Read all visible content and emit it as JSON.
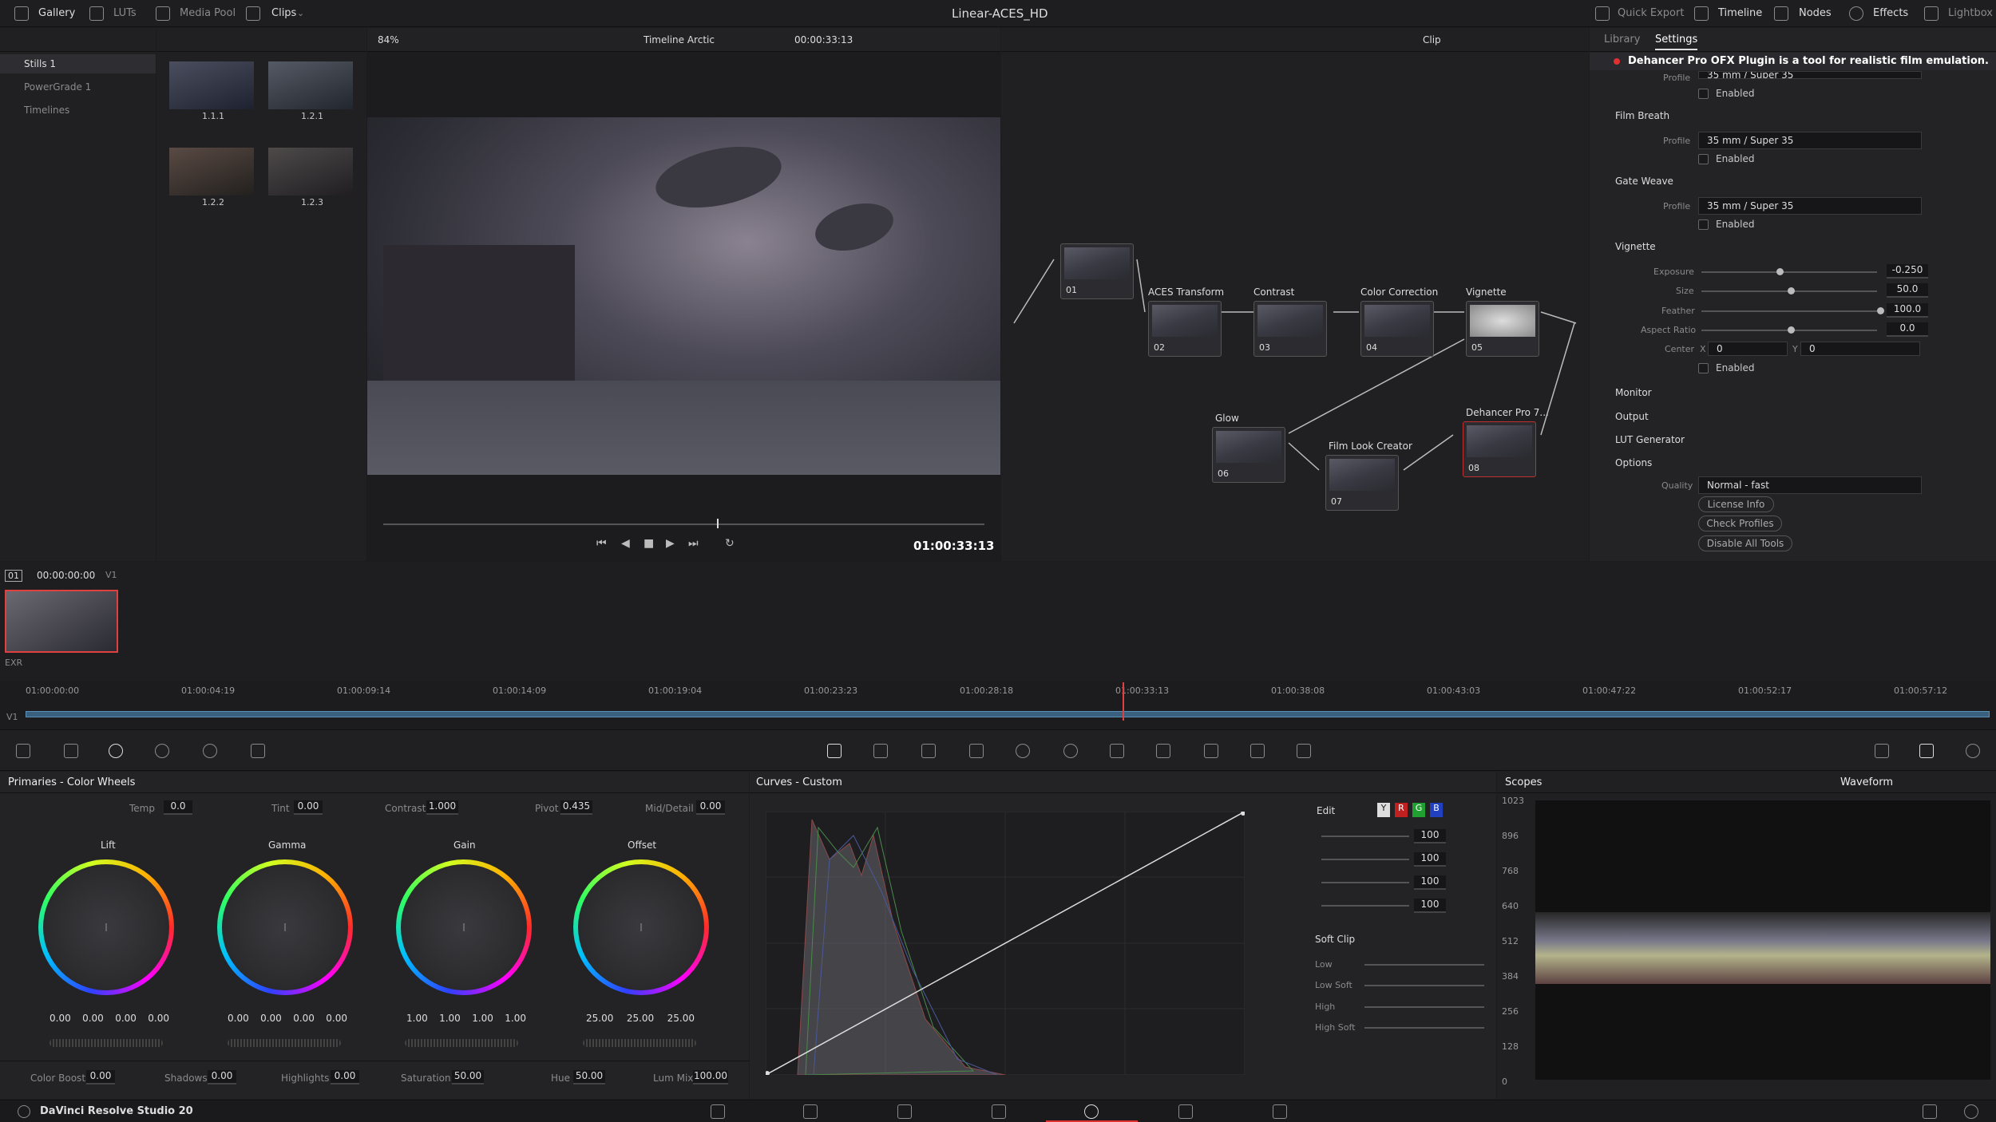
{
  "app": {
    "title": "Linear-ACES_HD",
    "brand": "DaVinci Resolve Studio 20"
  },
  "topbar": {
    "gallery": "Gallery",
    "luts": "LUTs",
    "media_pool": "Media Pool",
    "clips": "Clips",
    "quick_export": "Quick Export",
    "timeline": "Timeline",
    "nodes": "Nodes",
    "effects": "Effects",
    "lightbox": "Lightbox"
  },
  "gallery": {
    "items": [
      "Stills 1",
      "PowerGrade 1",
      "Timelines"
    ],
    "stills": [
      "1.1.1",
      "1.2.1",
      "1.2.2",
      "1.2.3"
    ]
  },
  "viewer": {
    "zoom": "84%",
    "timeline_name": "Timeline Arctic",
    "timecode_top": "00:00:33:13",
    "timecode": "01:00:33:13"
  },
  "node_editor": {
    "mode": "Clip",
    "nodes": [
      {
        "num": "01",
        "label": ""
      },
      {
        "num": "02",
        "label": "ACES Transform"
      },
      {
        "num": "03",
        "label": "Contrast"
      },
      {
        "num": "04",
        "label": "Color Correction"
      },
      {
        "num": "05",
        "label": "Vignette"
      },
      {
        "num": "06",
        "label": "Glow"
      },
      {
        "num": "07",
        "label": "Film Look Creator"
      },
      {
        "num": "08",
        "label": "Dehancer Pro 7..."
      }
    ]
  },
  "settings": {
    "tabs": [
      "Library",
      "Settings"
    ],
    "plugin_desc": "Dehancer Pro OFX Plugin is a tool for realistic film emulation.",
    "profile_label": "Profile",
    "top_profile": "35 mm / Super 35",
    "enabled": "Enabled",
    "film_breath": {
      "title": "Film Breath",
      "profile": "35 mm / Super 35"
    },
    "gate_weave": {
      "title": "Gate Weave",
      "profile": "35 mm / Super 35"
    },
    "vignette": {
      "title": "Vignette",
      "exposure_label": "Exposure",
      "exposure": "-0.250",
      "size_label": "Size",
      "size": "50.0",
      "feather_label": "Feather",
      "feather": "100.0",
      "aspect_label": "Aspect Ratio",
      "aspect": "0.0",
      "center_label": "Center",
      "cx_label": "X",
      "cx": "0",
      "cy_label": "Y",
      "cy": "0"
    },
    "collapsed": [
      "Monitor",
      "Output",
      "LUT Generator"
    ],
    "options": {
      "title": "Options",
      "quality_label": "Quality",
      "quality": "Normal - fast",
      "license": "License Info",
      "check": "Check Profiles",
      "disable": "Disable All Tools"
    }
  },
  "clip_strip": {
    "index": "01",
    "tc": "00:00:00:00",
    "track": "V1",
    "format": "EXR"
  },
  "timeline_ruler": {
    "track": "V1",
    "ticks": [
      "01:00:00:00",
      "01:00:04:19",
      "01:00:09:14",
      "01:00:14:09",
      "01:00:19:04",
      "01:00:23:23",
      "01:00:28:18",
      "01:00:33:13",
      "01:00:38:08",
      "01:00:43:03",
      "01:00:47:22",
      "01:00:52:17",
      "01:00:57:12"
    ]
  },
  "primaries": {
    "title": "Primaries - Color Wheels",
    "temp_label": "Temp",
    "temp": "0.0",
    "tint_label": "Tint",
    "tint": "0.00",
    "contrast_label": "Contrast",
    "contrast": "1.000",
    "pivot_label": "Pivot",
    "pivot": "0.435",
    "md_label": "Mid/Detail",
    "md": "0.00",
    "wheels": [
      {
        "name": "Lift",
        "vals": [
          "0.00",
          "0.00",
          "0.00",
          "0.00"
        ]
      },
      {
        "name": "Gamma",
        "vals": [
          "0.00",
          "0.00",
          "0.00",
          "0.00"
        ]
      },
      {
        "name": "Gain",
        "vals": [
          "1.00",
          "1.00",
          "1.00",
          "1.00"
        ]
      },
      {
        "name": "Offset",
        "vals": [
          "25.00",
          "25.00",
          "25.00"
        ]
      }
    ],
    "cb_label": "Color Boost",
    "cb": "0.00",
    "sh_label": "Shadows",
    "sh": "0.00",
    "hl_label": "Highlights",
    "hl": "0.00",
    "sat_label": "Saturation",
    "sat": "50.00",
    "hue_label": "Hue",
    "hue": "50.00",
    "lm_label": "Lum Mix",
    "lm": "100.00"
  },
  "curves": {
    "title": "Curves - Custom",
    "edit": "Edit",
    "ch": [
      "Y",
      "R",
      "G",
      "B"
    ],
    "intensity": [
      "100",
      "100",
      "100",
      "100"
    ],
    "soft_clip": "Soft Clip",
    "sc_rows": [
      "Low",
      "Low Soft",
      "High",
      "High Soft"
    ]
  },
  "scopes": {
    "title": "Scopes",
    "mode": "Waveform",
    "scale": [
      "1023",
      "896",
      "768",
      "640",
      "512",
      "384",
      "256",
      "128",
      "0"
    ]
  }
}
